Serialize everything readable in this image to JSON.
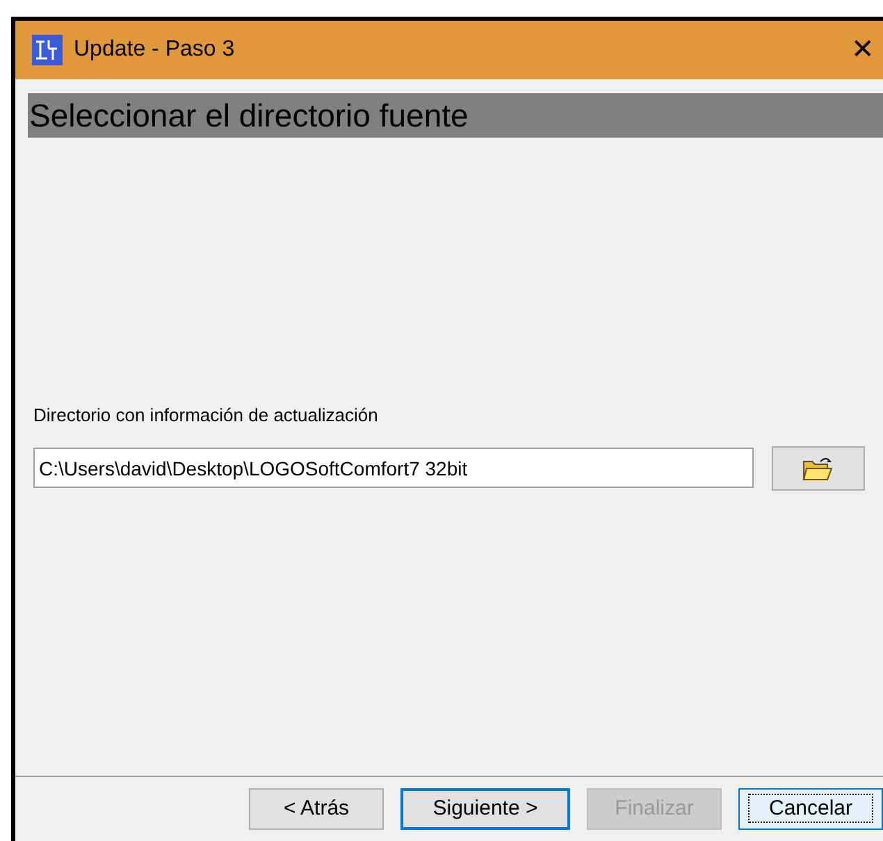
{
  "window": {
    "title": "Update - Paso 3",
    "close": "✕"
  },
  "header": "Seleccionar el directorio fuente",
  "directory": {
    "label": "Directorio con información de actualización",
    "value": "C:\\Users\\david\\Desktop\\LOGOSoftComfort7 32bit"
  },
  "buttons": [
    {
      "label": "< Atrás",
      "disabled": false,
      "default": false,
      "focused": false
    },
    {
      "label": "Siguiente >",
      "disabled": false,
      "default": true,
      "focused": false
    },
    {
      "label": "Finalizar",
      "disabled": true,
      "default": false,
      "focused": false
    },
    {
      "label": "Cancelar",
      "disabled": false,
      "default": false,
      "focused": true
    }
  ]
}
